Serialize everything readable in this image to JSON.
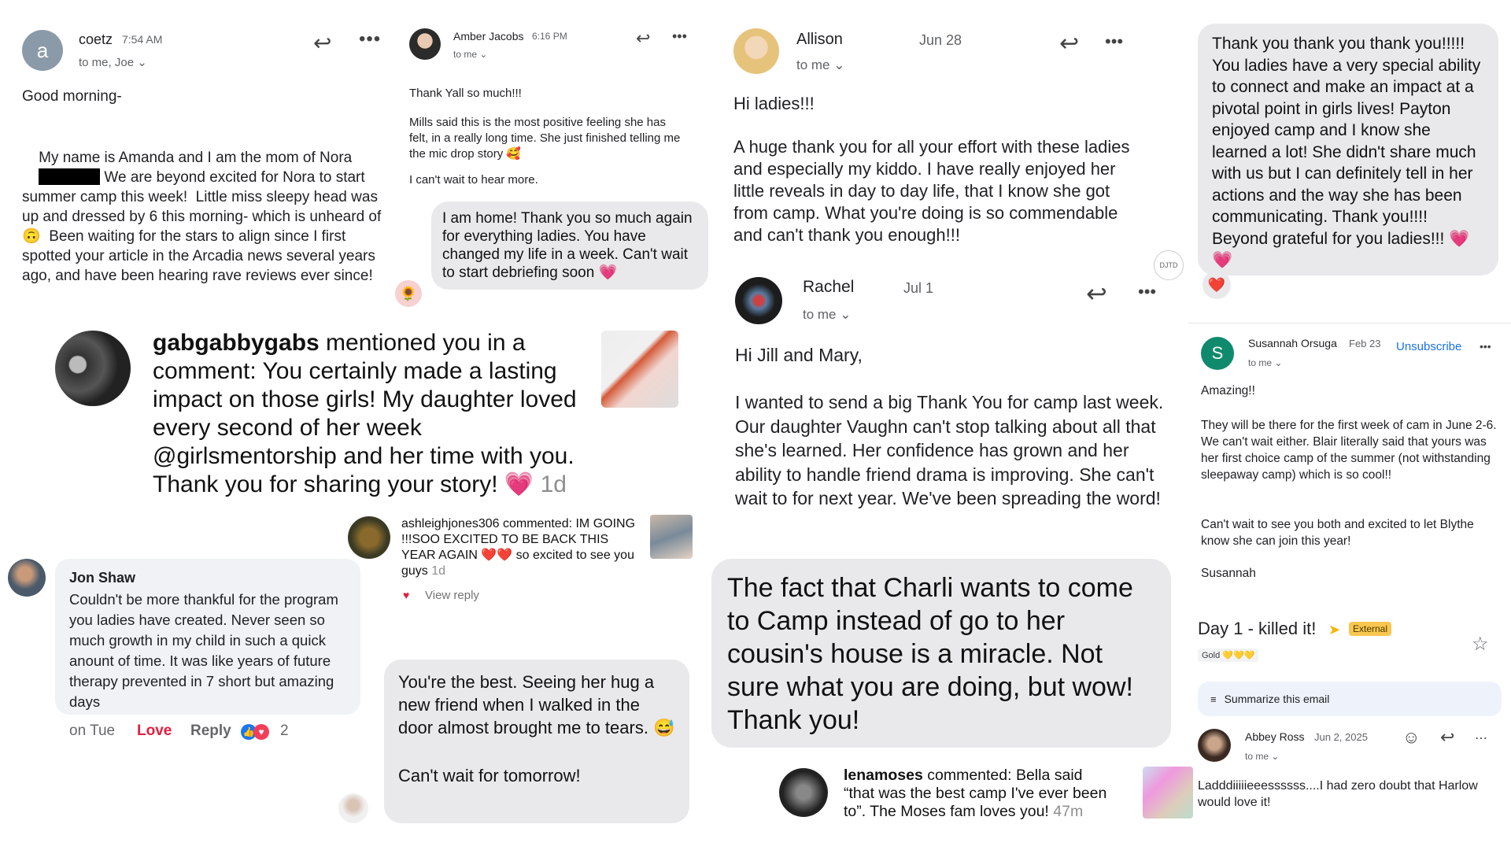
{
  "card1": {
    "avatar_letter": "a",
    "sender": "coetz",
    "time": "7:54 AM",
    "to": "to me, Joe",
    "greeting": "Good morning-",
    "body_1": "My name is Amanda and I am the mom of Nora",
    "body_2": " We are beyond excited for Nora to start summer camp this week!  Little miss sleepy head was up and dressed by 6 this morning- which is unheard of 🙃  Been waiting for the stars to align since I first spotted your article in the Arcadia news several years ago, and have been hearing rave reviews ever since!"
  },
  "card2": {
    "sender": "Amber Jacobs",
    "time": "6:16 PM",
    "to": "to me",
    "line1": "Thank Yall so much!!!",
    "line2": "Mills said this is the most positive feeling she has felt, in a really long time. She just finished telling me the mic drop story 🥰",
    "line3": "I can't wait to hear more.",
    "bubble": "I am home! Thank you so much again for everything ladies. You have changed my life in a week. Can't wait to start debriefing soon 💗"
  },
  "card3": {
    "sender": "Allison",
    "date": "Jun 28",
    "to": "to me",
    "greeting": "Hi ladies!!!",
    "body": "A huge thank you for all your effort with these ladies and especially my kiddo. I have really enjoyed her little reveals in day to day life, that I know she got from camp. What you're doing is so commendable and can't thank you enough!!!",
    "badge": "DJTD"
  },
  "card4": {
    "body": "Thank you thank you thank you!!!!! You ladies have a very special ability to connect and make an impact at a pivotal point in girls lives! Payton enjoyed camp and I know she learned a lot! She didn't share much with us but I can definitely tell in her actions and the way she has been communicating. Thank you!!!! Beyond grateful for you ladies!!! 💗💗",
    "reaction": "❤️"
  },
  "card5": {
    "handle": "gabgabbygabs",
    "text": " mentioned you in a comment: You certainly made a lasting impact on those girls! My daughter loved every second of her week @girlsmentorship and her time with you. Thank you for sharing your story! 💗",
    "age": "1d"
  },
  "card6": {
    "handle": "ashleighjones306",
    "text": " commented: IM GOING !!!SOO EXCITED TO BE BACK THIS YEAR AGAIN ❤️❤️ so excited to see you guys",
    "age": "1d",
    "view_reply": "View reply"
  },
  "card7": {
    "sender": "Rachel",
    "date": "Jul 1",
    "to": "to me",
    "greeting": "Hi Jill and Mary,",
    "body": "I wanted to send a big Thank You for camp last week. Our daughter Vaughn can't stop talking about all that she's learned. Her confidence has grown and her ability to handle friend drama is improving. She can't wait to for next year. We've been spreading the word!"
  },
  "card8": {
    "sender": "Susannah Orsuga",
    "date": "Feb 23",
    "unsubscribe": "Unsubscribe",
    "avatar_letter": "S",
    "to": "to me",
    "line1": "Amazing!!",
    "line2": "They will be there for the first week of cam in June 2-6. We can't wait either. Blair literally said that yours was her first choice camp of the summer (not withstanding sleepaway camp) which is so cool!!",
    "line3": "Can't wait to see you both and excited to let Blythe know she can join this year!",
    "signature": "Susannah"
  },
  "card9": {
    "name": "Jon Shaw",
    "text": "Couldn't be more thankful for the program you ladies have created.  Never seen so much growth in my child in such a quick anount of time.  It was like years of future therapy prevented in 7 short but amazing days",
    "when": "on Tue",
    "love": "Love",
    "reply": "Reply",
    "count": "2"
  },
  "card10": {
    "bubble1": "You're the best. Seeing her hug a new friend when I walked in the door almost brought me to tears. 😅",
    "bubble2": "Can't wait for tomorrow!"
  },
  "card11": {
    "text": "The fact that Charli wants to come to Camp instead of go to her cousin's house is a miracle. Not sure what you are doing, but wow! Thank you!"
  },
  "card12": {
    "handle": "lenamoses",
    "text": " commented: Bella said “that was the best camp I've ever been to”. The Moses fam loves you!",
    "age": "47m"
  },
  "card13": {
    "subject": "Day 1 - killed it!",
    "label_external": "External",
    "label_gold": "Gold 💛💛💛",
    "summarize": "Summarize this email",
    "sender": "Abbey Ross",
    "date": "Jun 2, 2025",
    "to": "to me",
    "body": "Ladddiiiiieeessssss....I had zero doubt that Harlow would love it!"
  },
  "colors": {
    "gmail_blue": "#1a73e8",
    "teal_avatar": "#0f8a6c",
    "love_red": "#e41e3f",
    "bubble_gray": "#e9e9eb",
    "external_yellow": "#f9c74f"
  }
}
